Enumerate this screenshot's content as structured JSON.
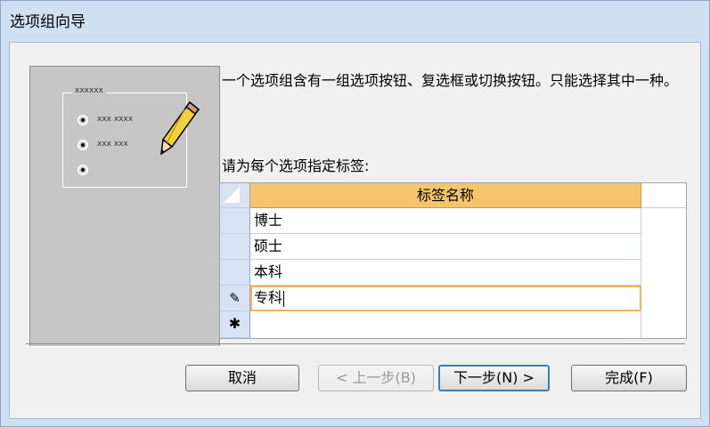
{
  "window": {
    "title": "选项组向导"
  },
  "illustration": {
    "group_title": "xxxxxx",
    "rows": [
      "xxx xxxx",
      "xxx xxx",
      ""
    ]
  },
  "description": "一个选项组含有一组选项按钮、复选框或切换按钮。只能选择其中一种。",
  "prompt": "请为每个选项指定标签:",
  "grid": {
    "column_header": "标签名称",
    "rows": [
      "博士",
      "硕士",
      "本科",
      "专科"
    ],
    "editing_indicator": "✎",
    "new_row_indicator": "✱"
  },
  "buttons": {
    "cancel": "取消",
    "back": "< 上一步(B)",
    "next": "下一步(N) >",
    "finish": "完成(F)"
  }
}
